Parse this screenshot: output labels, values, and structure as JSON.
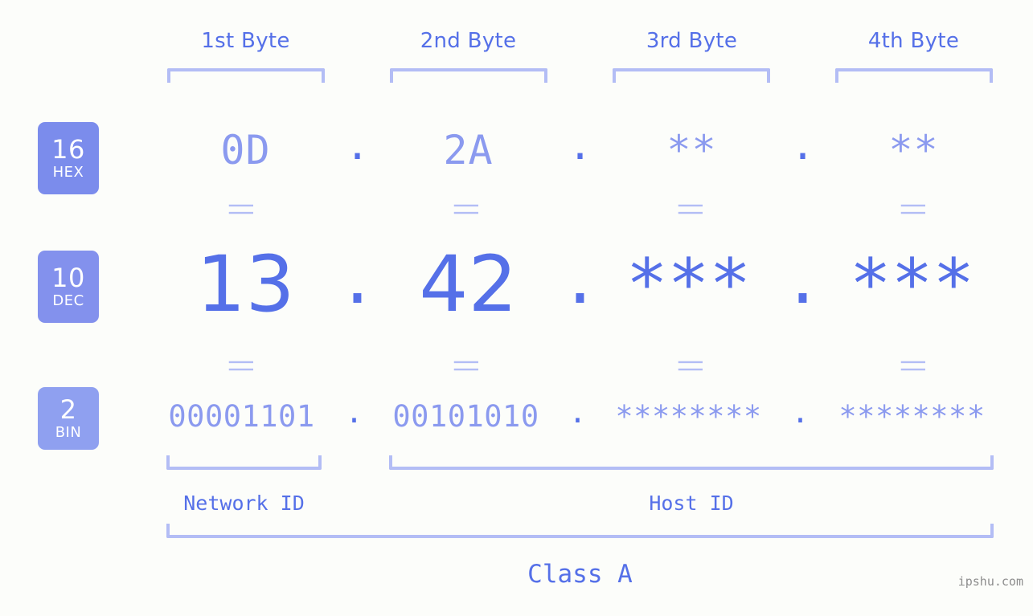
{
  "page": {
    "background_color": "#fcfdfa",
    "accent_color": "#5570e8",
    "muted_color": "#8b9aef",
    "bracket_color": "#b3bdf5",
    "badge_color": "#7b8cec"
  },
  "byte_headers": [
    {
      "label": "1st Byte"
    },
    {
      "label": "2nd Byte"
    },
    {
      "label": "3rd Byte"
    },
    {
      "label": "4th Byte"
    }
  ],
  "rows": [
    {
      "badge": {
        "base": "16",
        "name": "HEX"
      },
      "values": [
        "0D",
        "2A",
        "**",
        "**"
      ],
      "separator": "."
    },
    {
      "badge": {
        "base": "10",
        "name": "DEC"
      },
      "values": [
        "13",
        "42",
        "***",
        "***"
      ],
      "separator": "."
    },
    {
      "badge": {
        "base": "2",
        "name": "BIN"
      },
      "values": [
        "00001101",
        "00101010",
        "********",
        "********"
      ],
      "separator": "."
    }
  ],
  "equals_marks": [
    "||",
    "||",
    "||",
    "||",
    "||",
    "||",
    "||",
    "||"
  ],
  "id_sections": [
    {
      "label": "Network ID"
    },
    {
      "label": "Host ID"
    }
  ],
  "class_label": "Class A",
  "watermark": "ipshu.com"
}
